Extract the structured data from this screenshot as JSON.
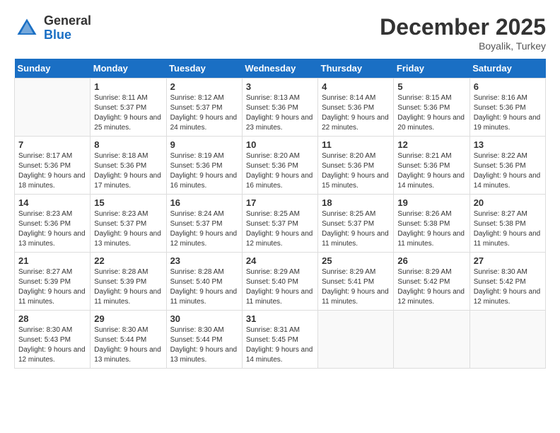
{
  "header": {
    "logo_general": "General",
    "logo_blue": "Blue",
    "month_title": "December 2025",
    "location": "Boyalik, Turkey"
  },
  "days_of_week": [
    "Sunday",
    "Monday",
    "Tuesday",
    "Wednesday",
    "Thursday",
    "Friday",
    "Saturday"
  ],
  "weeks": [
    [
      {
        "day": "",
        "sunrise": "",
        "sunset": "",
        "daylight": ""
      },
      {
        "day": "1",
        "sunrise": "Sunrise: 8:11 AM",
        "sunset": "Sunset: 5:37 PM",
        "daylight": "Daylight: 9 hours and 25 minutes."
      },
      {
        "day": "2",
        "sunrise": "Sunrise: 8:12 AM",
        "sunset": "Sunset: 5:37 PM",
        "daylight": "Daylight: 9 hours and 24 minutes."
      },
      {
        "day": "3",
        "sunrise": "Sunrise: 8:13 AM",
        "sunset": "Sunset: 5:36 PM",
        "daylight": "Daylight: 9 hours and 23 minutes."
      },
      {
        "day": "4",
        "sunrise": "Sunrise: 8:14 AM",
        "sunset": "Sunset: 5:36 PM",
        "daylight": "Daylight: 9 hours and 22 minutes."
      },
      {
        "day": "5",
        "sunrise": "Sunrise: 8:15 AM",
        "sunset": "Sunset: 5:36 PM",
        "daylight": "Daylight: 9 hours and 20 minutes."
      },
      {
        "day": "6",
        "sunrise": "Sunrise: 8:16 AM",
        "sunset": "Sunset: 5:36 PM",
        "daylight": "Daylight: 9 hours and 19 minutes."
      }
    ],
    [
      {
        "day": "7",
        "sunrise": "Sunrise: 8:17 AM",
        "sunset": "Sunset: 5:36 PM",
        "daylight": "Daylight: 9 hours and 18 minutes."
      },
      {
        "day": "8",
        "sunrise": "Sunrise: 8:18 AM",
        "sunset": "Sunset: 5:36 PM",
        "daylight": "Daylight: 9 hours and 17 minutes."
      },
      {
        "day": "9",
        "sunrise": "Sunrise: 8:19 AM",
        "sunset": "Sunset: 5:36 PM",
        "daylight": "Daylight: 9 hours and 16 minutes."
      },
      {
        "day": "10",
        "sunrise": "Sunrise: 8:20 AM",
        "sunset": "Sunset: 5:36 PM",
        "daylight": "Daylight: 9 hours and 16 minutes."
      },
      {
        "day": "11",
        "sunrise": "Sunrise: 8:20 AM",
        "sunset": "Sunset: 5:36 PM",
        "daylight": "Daylight: 9 hours and 15 minutes."
      },
      {
        "day": "12",
        "sunrise": "Sunrise: 8:21 AM",
        "sunset": "Sunset: 5:36 PM",
        "daylight": "Daylight: 9 hours and 14 minutes."
      },
      {
        "day": "13",
        "sunrise": "Sunrise: 8:22 AM",
        "sunset": "Sunset: 5:36 PM",
        "daylight": "Daylight: 9 hours and 14 minutes."
      }
    ],
    [
      {
        "day": "14",
        "sunrise": "Sunrise: 8:23 AM",
        "sunset": "Sunset: 5:36 PM",
        "daylight": "Daylight: 9 hours and 13 minutes."
      },
      {
        "day": "15",
        "sunrise": "Sunrise: 8:23 AM",
        "sunset": "Sunset: 5:37 PM",
        "daylight": "Daylight: 9 hours and 13 minutes."
      },
      {
        "day": "16",
        "sunrise": "Sunrise: 8:24 AM",
        "sunset": "Sunset: 5:37 PM",
        "daylight": "Daylight: 9 hours and 12 minutes."
      },
      {
        "day": "17",
        "sunrise": "Sunrise: 8:25 AM",
        "sunset": "Sunset: 5:37 PM",
        "daylight": "Daylight: 9 hours and 12 minutes."
      },
      {
        "day": "18",
        "sunrise": "Sunrise: 8:25 AM",
        "sunset": "Sunset: 5:37 PM",
        "daylight": "Daylight: 9 hours and 11 minutes."
      },
      {
        "day": "19",
        "sunrise": "Sunrise: 8:26 AM",
        "sunset": "Sunset: 5:38 PM",
        "daylight": "Daylight: 9 hours and 11 minutes."
      },
      {
        "day": "20",
        "sunrise": "Sunrise: 8:27 AM",
        "sunset": "Sunset: 5:38 PM",
        "daylight": "Daylight: 9 hours and 11 minutes."
      }
    ],
    [
      {
        "day": "21",
        "sunrise": "Sunrise: 8:27 AM",
        "sunset": "Sunset: 5:39 PM",
        "daylight": "Daylight: 9 hours and 11 minutes."
      },
      {
        "day": "22",
        "sunrise": "Sunrise: 8:28 AM",
        "sunset": "Sunset: 5:39 PM",
        "daylight": "Daylight: 9 hours and 11 minutes."
      },
      {
        "day": "23",
        "sunrise": "Sunrise: 8:28 AM",
        "sunset": "Sunset: 5:40 PM",
        "daylight": "Daylight: 9 hours and 11 minutes."
      },
      {
        "day": "24",
        "sunrise": "Sunrise: 8:29 AM",
        "sunset": "Sunset: 5:40 PM",
        "daylight": "Daylight: 9 hours and 11 minutes."
      },
      {
        "day": "25",
        "sunrise": "Sunrise: 8:29 AM",
        "sunset": "Sunset: 5:41 PM",
        "daylight": "Daylight: 9 hours and 11 minutes."
      },
      {
        "day": "26",
        "sunrise": "Sunrise: 8:29 AM",
        "sunset": "Sunset: 5:42 PM",
        "daylight": "Daylight: 9 hours and 12 minutes."
      },
      {
        "day": "27",
        "sunrise": "Sunrise: 8:30 AM",
        "sunset": "Sunset: 5:42 PM",
        "daylight": "Daylight: 9 hours and 12 minutes."
      }
    ],
    [
      {
        "day": "28",
        "sunrise": "Sunrise: 8:30 AM",
        "sunset": "Sunset: 5:43 PM",
        "daylight": "Daylight: 9 hours and 12 minutes."
      },
      {
        "day": "29",
        "sunrise": "Sunrise: 8:30 AM",
        "sunset": "Sunset: 5:44 PM",
        "daylight": "Daylight: 9 hours and 13 minutes."
      },
      {
        "day": "30",
        "sunrise": "Sunrise: 8:30 AM",
        "sunset": "Sunset: 5:44 PM",
        "daylight": "Daylight: 9 hours and 13 minutes."
      },
      {
        "day": "31",
        "sunrise": "Sunrise: 8:31 AM",
        "sunset": "Sunset: 5:45 PM",
        "daylight": "Daylight: 9 hours and 14 minutes."
      },
      {
        "day": "",
        "sunrise": "",
        "sunset": "",
        "daylight": ""
      },
      {
        "day": "",
        "sunrise": "",
        "sunset": "",
        "daylight": ""
      },
      {
        "day": "",
        "sunrise": "",
        "sunset": "",
        "daylight": ""
      }
    ]
  ]
}
